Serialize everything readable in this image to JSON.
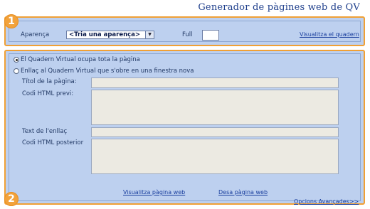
{
  "header": {
    "title": "Generador de pàgines web de QV"
  },
  "section1": {
    "badge": "1",
    "appearance_label": "Aparença",
    "appearance_select_value": "<Tria una aparença>",
    "full_label": "Full",
    "full_value": "",
    "view_notebook_link": "Visualitza el quadern"
  },
  "section2": {
    "badge": "2",
    "radio_full_page": "El Quadern Virtual ocupa tota la pàgina",
    "radio_link_window": "Enllaç al Quadern Virtual que s'obre en una finestra nova",
    "page_title_label": "Títol de la pàgina:",
    "prev_html_label": "Codi HTML previ:",
    "link_text_label": "Text de l'enllaç",
    "post_html_label": "Codi HTML posterior",
    "view_page_link": "Visualitza pàgina web",
    "save_page_link": "Desa pàgina web",
    "advanced_options_link": "Opcions Avançades>>"
  },
  "colors": {
    "accent": "#f0a035",
    "panel": "#bdd0ef",
    "title": "#1f3f8c"
  }
}
